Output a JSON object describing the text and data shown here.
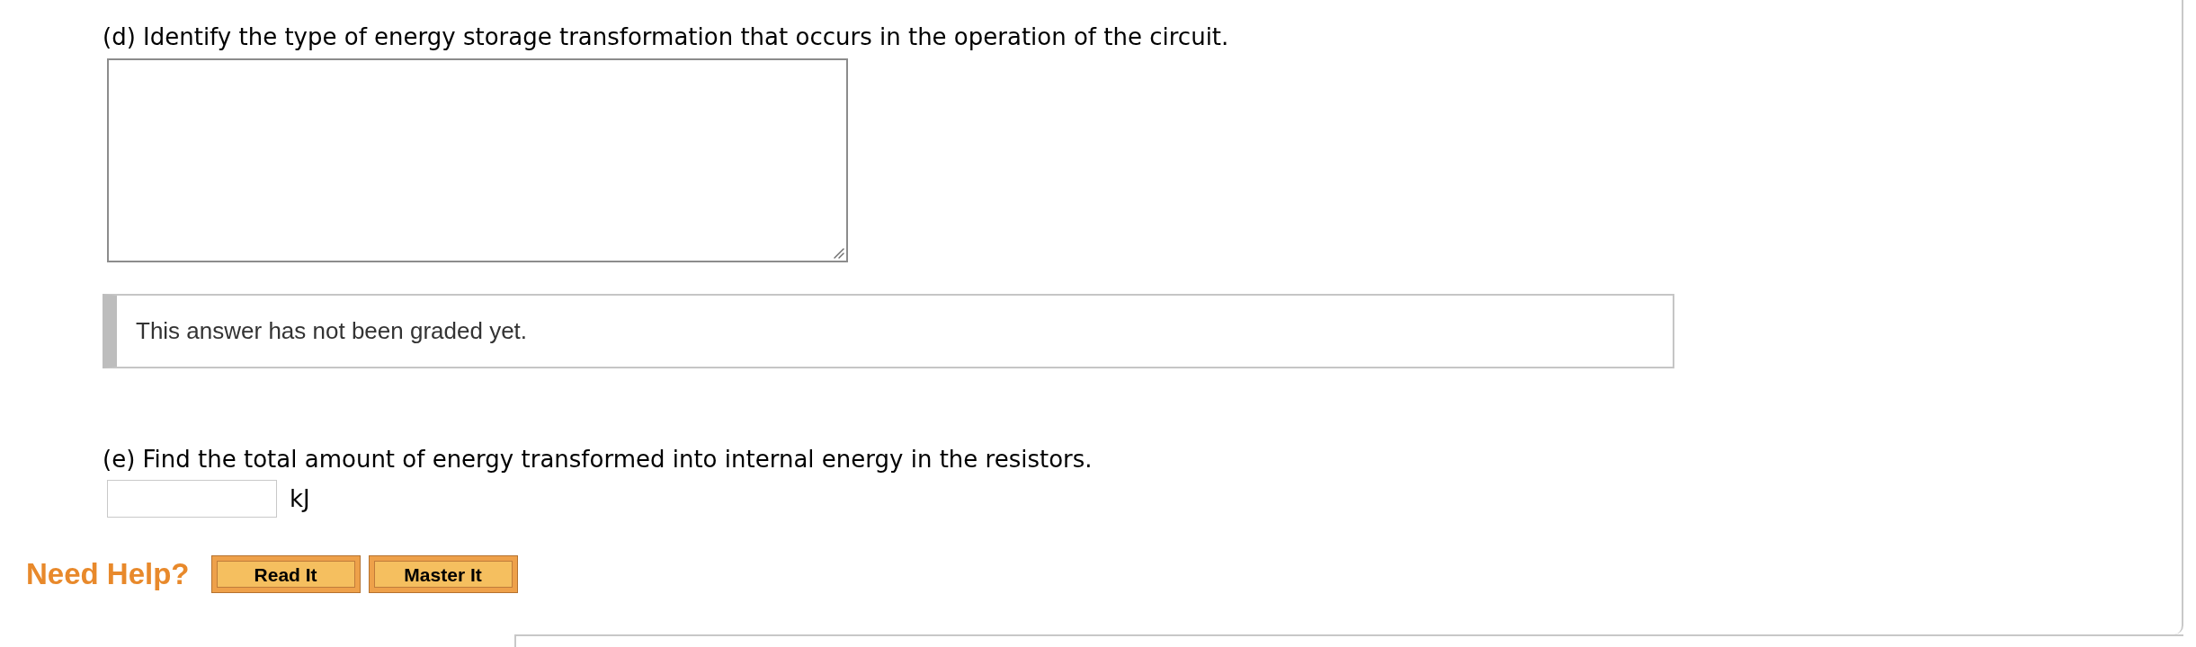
{
  "parts": [
    {
      "kind": "essay",
      "prompt": "(d) Identify the type of energy storage transformation that occurs in the operation of the circuit.",
      "feedback": "This answer has not been graded yet."
    },
    {
      "kind": "numeric",
      "prompt": "(e) Find the total amount of energy transformed into internal energy in the resistors.",
      "unit": "kJ"
    }
  ],
  "help": {
    "label": "Need Help?",
    "buttons": [
      "Read It",
      "Master It"
    ]
  }
}
